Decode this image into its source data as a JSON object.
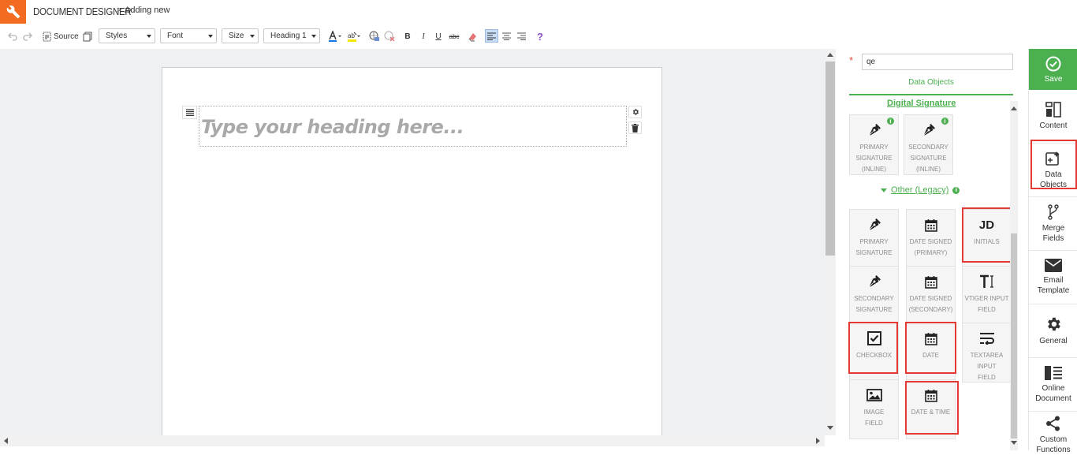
{
  "header": {
    "app_title": "DOCUMENT DESIGNER",
    "separator": ">",
    "page": "Adding new"
  },
  "toolbar": {
    "source_label": "Source",
    "styles_label": "Styles",
    "font_label": "Font",
    "size_label": "Size",
    "format_label": "Heading 1",
    "bold": "B",
    "italic": "I",
    "underline": "U",
    "strike": "abc",
    "help": "?"
  },
  "editor": {
    "heading_placeholder": "Type your heading here..."
  },
  "panel": {
    "search_value": "qe",
    "required_marker": "*",
    "tab_label": "Data Objects",
    "sections": {
      "digital_signature": "Digital Signature",
      "other_legacy": "Other (Legacy)"
    },
    "digital_tiles": [
      {
        "label": "PRIMARY\nSIGNATURE\n(INLINE)",
        "icon": "pen-nib-icon"
      },
      {
        "label": "SECONDARY\nSIGNATURE\n(INLINE)",
        "icon": "pen-nib-icon"
      }
    ],
    "legacy_tiles": [
      {
        "label": "PRIMARY\nSIGNATURE",
        "icon": "pen-nib-icon",
        "highlighted": false
      },
      {
        "label": "DATE SIGNED\n(PRIMARY)",
        "icon": "calendar-icon",
        "highlighted": false
      },
      {
        "label": "INITIALS",
        "icon_text": "JD",
        "highlighted": true
      },
      {
        "label": "SECONDARY\nSIGNATURE",
        "icon": "pen-nib-icon",
        "highlighted": false
      },
      {
        "label": "DATE SIGNED\n(SECONDARY)",
        "icon": "calendar-icon",
        "highlighted": false
      },
      {
        "label": "VTIGER INPUT\nFIELD",
        "icon": "text-cursor-icon",
        "highlighted": false
      },
      {
        "label": "CHECKBOX",
        "icon": "checkbox-icon",
        "highlighted": true
      },
      {
        "label": "DATE",
        "icon": "calendar-icon",
        "highlighted": true
      },
      {
        "label": "TEXTAREA INPUT\nFIELD",
        "icon": "wrap-text-icon",
        "highlighted": false
      },
      {
        "label": "IMAGE\nFIELD",
        "icon": "image-icon",
        "highlighted": false
      },
      {
        "label": "DATE & TIME",
        "icon": "calendar-icon",
        "highlighted": true
      }
    ]
  },
  "sidebar": {
    "save_label": "Save",
    "items": [
      {
        "label": "Content",
        "icon": "content-icon",
        "highlighted": false
      },
      {
        "label": "Data\nObjects",
        "icon": "data-objects-icon",
        "highlighted": true
      },
      {
        "label": "Merge\nFields",
        "icon": "merge-icon",
        "highlighted": false
      },
      {
        "label": "Email\nTemplate",
        "icon": "envelope-icon",
        "highlighted": false
      },
      {
        "label": "General",
        "icon": "gear-icon",
        "highlighted": false
      },
      {
        "label": "Online\nDocument",
        "icon": "document-icon",
        "highlighted": false
      },
      {
        "label": "Custom\nFunctions",
        "icon": "share-icon",
        "highlighted": false
      }
    ]
  },
  "colors": {
    "brand": "#f26b21",
    "accent": "#4caf50",
    "highlight": "#e53935"
  }
}
